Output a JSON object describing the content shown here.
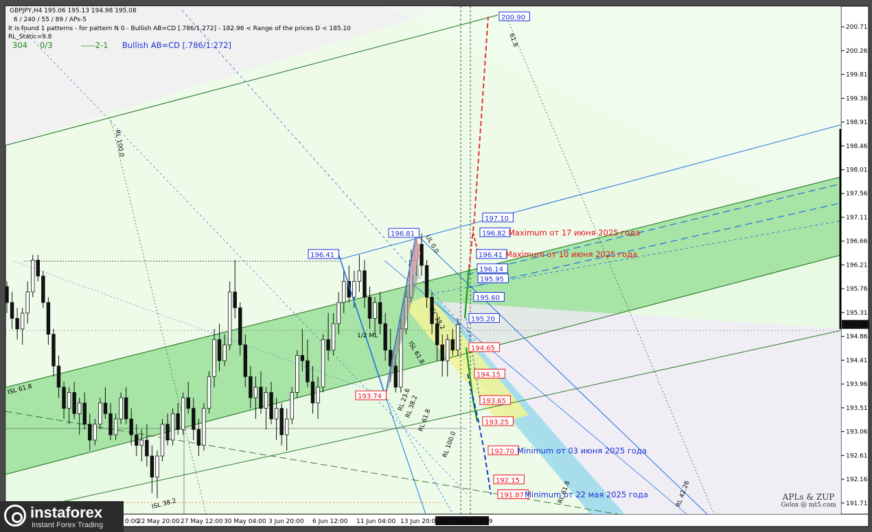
{
  "header": {
    "symbol_line": "GBPJPY,H4  195.06 195.13 194.98 195.08",
    "params_line": "6 / 240 / 55 / 89 / APs-5",
    "pattern_line": "It is found 1 patterns  -  for pattern N 0 - Bullish AB=CD [.786/1.272] - 182.96 < Range of the prices D < 185.10",
    "static_line": "RL_Static=9.8",
    "counter_a": "304",
    "counter_b": "0/3",
    "counter_c": "-----2-1",
    "pattern_name": "Bullish AB=CD [.786/1.272]"
  },
  "colors": {
    "plot_bg": "#eefbe9",
    "channel_fill": "#8fdc8f",
    "up_color": "#111111",
    "blue_line": "#1e6fe0",
    "red_label": "#e8101a",
    "blue_label": "#1a2fd8",
    "projection_red": "#e83030",
    "projection_blue": "#1a35c8",
    "cyan_band": "#8fd8e8",
    "yellow_zone": "#eef39a"
  },
  "chart_data": {
    "type": "candlestick",
    "symbol": "GBPJPY",
    "timeframe": "H4",
    "ylim": [
      191.5,
      201.1
    ],
    "y_ticks": [
      200.71,
      200.26,
      199.81,
      199.36,
      198.91,
      198.46,
      198.01,
      197.56,
      197.11,
      196.66,
      196.21,
      195.76,
      195.31,
      194.86,
      194.41,
      193.96,
      193.51,
      193.06,
      192.61,
      192.16,
      191.71
    ],
    "x_ticks": [
      "0:00",
      "22 May 20:00",
      "27 May 12:00",
      "30 May 04:00",
      "3 Jun 20:00",
      "6 Jun 12:00",
      "11 Jun 04:00",
      "13 Jun 20:00"
    ],
    "current_time_label": "2025.06.19 12:29",
    "current_price": 195.08,
    "price_levels_red": [
      194.65,
      194.15,
      193.65,
      193.25,
      192.7,
      192.15,
      191.87
    ],
    "price_levels_blue": [
      200.9,
      197.1,
      196.82,
      196.41,
      196.14,
      195.95,
      195.6,
      195.2
    ],
    "swing_labels": [
      {
        "value": "196.41",
        "color": "blue"
      },
      {
        "value": "196.81",
        "color": "blue"
      },
      {
        "value": "193.74",
        "color": "red"
      }
    ],
    "annotations": [
      {
        "text": "Maximum от 17 июня 2025 года",
        "color": "red",
        "price": 196.82
      },
      {
        "text": "Maximum от 10 июня 2025 года",
        "color": "red",
        "price": 196.41
      },
      {
        "text": "Minimum от 03 июня 2025 года",
        "color": "blue",
        "price": 192.7
      },
      {
        "text": "Minimum от 22 мая 2025 года",
        "color": "blue",
        "price": 191.87
      }
    ],
    "fib_labels": [
      "RL 100.0",
      "ISL 61.8",
      "ISL 38.2",
      "1/2 ML",
      "RL 23.6",
      "RL 38.2",
      "RL 61.8",
      "RL 100.0",
      "ISL 61.8",
      "ISL 38.2",
      "61.8",
      "RL 42.26",
      "RL 61.8",
      "UL 0.0"
    ],
    "candles": [
      [
        195.8,
        195.9,
        195.3,
        195.5
      ],
      [
        195.5,
        195.7,
        195.0,
        195.2
      ],
      [
        195.2,
        195.4,
        194.8,
        195.0
      ],
      [
        195.0,
        195.4,
        194.7,
        195.3
      ],
      [
        195.3,
        195.9,
        195.1,
        195.7
      ],
      [
        195.7,
        196.4,
        195.6,
        196.3
      ],
      [
        196.3,
        196.4,
        195.9,
        196.0
      ],
      [
        196.0,
        196.1,
        195.4,
        195.5
      ],
      [
        195.5,
        195.6,
        194.7,
        194.9
      ],
      [
        194.9,
        195.0,
        194.1,
        194.3
      ],
      [
        194.3,
        194.5,
        193.7,
        193.9
      ],
      [
        193.9,
        194.0,
        193.3,
        193.5
      ],
      [
        193.5,
        193.9,
        193.2,
        193.8
      ],
      [
        193.8,
        194.0,
        193.3,
        193.4
      ],
      [
        193.4,
        193.7,
        193.0,
        193.6
      ],
      [
        193.6,
        193.8,
        193.1,
        193.2
      ],
      [
        193.2,
        193.4,
        192.7,
        192.9
      ],
      [
        192.9,
        193.3,
        192.8,
        193.2
      ],
      [
        193.2,
        193.7,
        193.1,
        193.6
      ],
      [
        193.6,
        193.9,
        193.3,
        193.4
      ],
      [
        193.4,
        193.6,
        192.9,
        193.0
      ],
      [
        193.0,
        193.4,
        192.9,
        193.3
      ],
      [
        193.3,
        193.8,
        193.2,
        193.7
      ],
      [
        193.7,
        193.9,
        193.2,
        193.3
      ],
      [
        193.3,
        193.5,
        192.8,
        193.0
      ],
      [
        193.0,
        193.2,
        192.6,
        192.8
      ],
      [
        192.8,
        193.1,
        192.5,
        192.9
      ],
      [
        192.9,
        193.2,
        192.4,
        192.6
      ],
      [
        192.6,
        192.8,
        191.9,
        192.2
      ],
      [
        192.2,
        192.7,
        191.8,
        192.6
      ],
      [
        192.6,
        193.3,
        192.5,
        193.2
      ],
      [
        193.2,
        193.4,
        192.8,
        192.9
      ],
      [
        192.9,
        193.5,
        192.8,
        193.4
      ],
      [
        193.4,
        193.6,
        193.0,
        193.1
      ],
      [
        193.1,
        193.8,
        193.0,
        193.7
      ],
      [
        193.7,
        194.0,
        193.4,
        193.5
      ],
      [
        193.5,
        193.7,
        192.9,
        193.1
      ],
      [
        193.1,
        193.3,
        192.6,
        192.8
      ],
      [
        192.8,
        193.6,
        192.7,
        193.5
      ],
      [
        193.5,
        194.2,
        193.4,
        194.1
      ],
      [
        194.1,
        195.0,
        193.9,
        194.8
      ],
      [
        194.8,
        195.1,
        194.2,
        194.4
      ],
      [
        194.4,
        194.9,
        194.3,
        194.7
      ],
      [
        194.7,
        195.9,
        194.6,
        195.7
      ],
      [
        195.7,
        196.3,
        195.2,
        195.4
      ],
      [
        195.4,
        195.5,
        194.5,
        194.7
      ],
      [
        194.7,
        194.9,
        193.9,
        194.1
      ],
      [
        194.1,
        194.3,
        193.5,
        193.7
      ],
      [
        193.7,
        194.1,
        193.3,
        193.9
      ],
      [
        193.9,
        194.2,
        193.4,
        193.5
      ],
      [
        193.5,
        193.9,
        193.1,
        193.8
      ],
      [
        193.8,
        194.0,
        193.2,
        193.3
      ],
      [
        193.3,
        193.7,
        192.9,
        193.5
      ],
      [
        193.5,
        193.6,
        192.8,
        193.0
      ],
      [
        193.0,
        193.5,
        192.7,
        193.3
      ],
      [
        193.3,
        193.9,
        193.2,
        193.8
      ],
      [
        193.8,
        194.6,
        193.7,
        194.5
      ],
      [
        194.5,
        195.0,
        194.2,
        194.4
      ],
      [
        194.4,
        194.8,
        193.9,
        194.0
      ],
      [
        194.0,
        194.3,
        193.4,
        193.6
      ],
      [
        193.6,
        194.1,
        193.3,
        193.9
      ],
      [
        193.9,
        194.9,
        193.8,
        194.8
      ],
      [
        194.8,
        195.3,
        194.4,
        194.6
      ],
      [
        194.6,
        195.3,
        194.5,
        195.1
      ],
      [
        195.1,
        195.7,
        194.9,
        195.5
      ],
      [
        195.5,
        196.1,
        195.3,
        195.9
      ],
      [
        195.9,
        196.2,
        195.5,
        195.6
      ],
      [
        195.6,
        196.1,
        195.4,
        195.9
      ],
      [
        195.9,
        196.4,
        195.7,
        196.1
      ],
      [
        196.1,
        196.3,
        195.4,
        195.6
      ],
      [
        195.6,
        195.8,
        195.0,
        195.2
      ],
      [
        195.2,
        195.6,
        194.9,
        195.5
      ],
      [
        195.5,
        195.7,
        194.9,
        195.1
      ],
      [
        195.1,
        195.3,
        194.4,
        194.6
      ],
      [
        194.6,
        195.0,
        194.0,
        194.3
      ],
      [
        194.3,
        194.5,
        193.8,
        193.9
      ],
      [
        193.9,
        195.2,
        193.8,
        195.0
      ],
      [
        195.0,
        195.8,
        194.9,
        195.6
      ],
      [
        195.6,
        196.5,
        195.5,
        196.3
      ],
      [
        196.3,
        196.8,
        196.0,
        196.6
      ],
      [
        196.6,
        196.8,
        196.0,
        196.2
      ],
      [
        196.2,
        196.3,
        195.4,
        195.6
      ],
      [
        195.6,
        195.7,
        194.9,
        195.1
      ],
      [
        195.1,
        195.3,
        194.4,
        194.7
      ],
      [
        194.7,
        194.9,
        194.1,
        194.4
      ],
      [
        194.4,
        194.9,
        194.1,
        194.8
      ],
      [
        194.8,
        195.0,
        194.5,
        194.6
      ],
      [
        194.6,
        195.2,
        194.5,
        195.08
      ]
    ]
  },
  "logo": {
    "name": "instaforex",
    "tagline": "Instant Forex Trading"
  },
  "signature": {
    "title": "APLs & ZUP",
    "subtitle": "Gelox @ mt5.com"
  }
}
